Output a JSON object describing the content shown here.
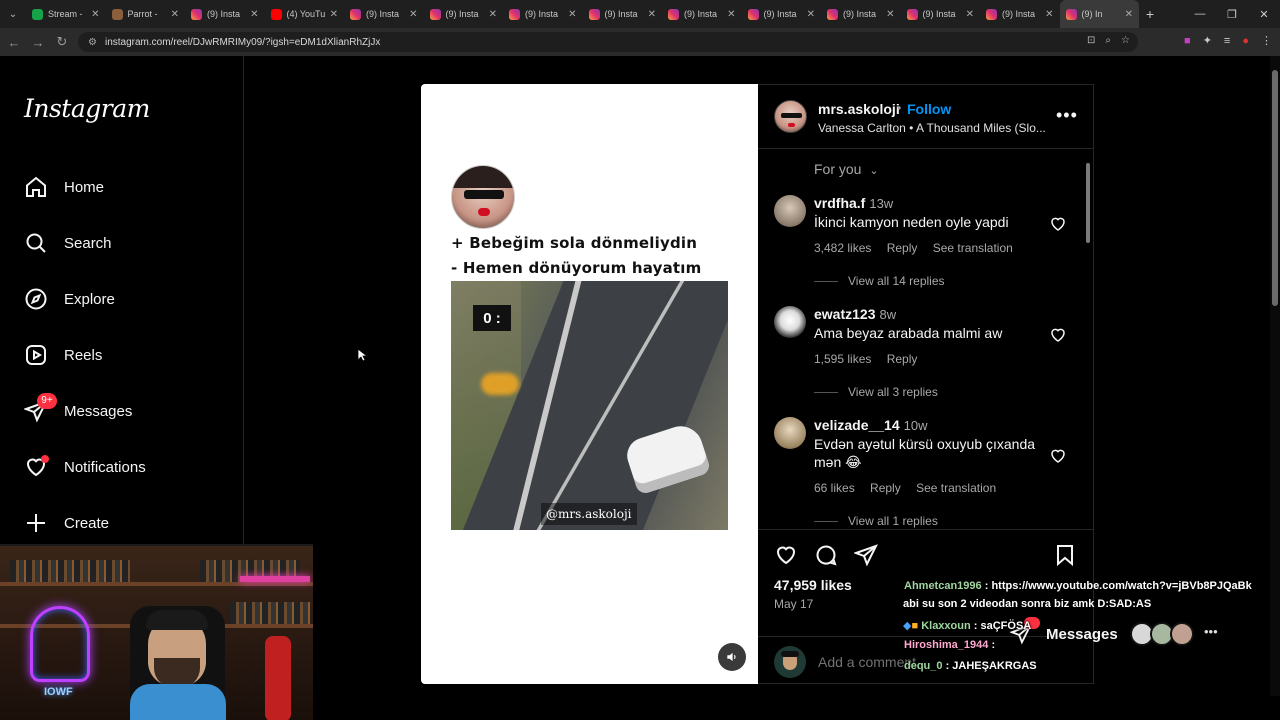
{
  "browser": {
    "tabs": [
      {
        "title": "Stream -",
        "icon": "stream-icon"
      },
      {
        "title": "Parrot -",
        "icon": "parrot-icon"
      },
      {
        "title": "(9) Insta",
        "icon": "instagram-icon"
      },
      {
        "title": "(4) YouTu",
        "icon": "youtube-icon"
      },
      {
        "title": "(9) Insta",
        "icon": "instagram-icon"
      },
      {
        "title": "(9) Insta",
        "icon": "instagram-icon"
      },
      {
        "title": "(9) Insta",
        "icon": "instagram-icon"
      },
      {
        "title": "(9) Insta",
        "icon": "instagram-icon"
      },
      {
        "title": "(9) Insta",
        "icon": "instagram-icon"
      },
      {
        "title": "(9) Insta",
        "icon": "instagram-icon"
      },
      {
        "title": "(9) Insta",
        "icon": "instagram-icon"
      },
      {
        "title": "(9) Insta",
        "icon": "instagram-icon"
      },
      {
        "title": "(9) Insta",
        "icon": "instagram-icon"
      },
      {
        "title": "(9) In",
        "icon": "instagram-icon",
        "active": true
      }
    ],
    "url": "instagram.com/reel/DJwRMRIMy09/?igsh=eDM1dXlianRhZjJx"
  },
  "sidebar": {
    "logo": "Instagram",
    "items": [
      {
        "label": "Home",
        "icon": "home-icon"
      },
      {
        "label": "Search",
        "icon": "search-icon"
      },
      {
        "label": "Explore",
        "icon": "compass-icon"
      },
      {
        "label": "Reels",
        "icon": "reels-icon"
      },
      {
        "label": "Messages",
        "icon": "messenger-icon",
        "badge": "9+"
      },
      {
        "label": "Notifications",
        "icon": "heart-icon"
      },
      {
        "label": "Create",
        "icon": "plus-icon"
      }
    ]
  },
  "reel": {
    "caption_line1": "+ Bebeğim sola dönmeliydin",
    "caption_line2": "- Hemen dönüyorum hayatım",
    "timer": "0 :",
    "watermark": "@mrs.askoloji"
  },
  "post": {
    "username": "mrs.askoloji",
    "separator": "•",
    "follow": "Follow",
    "audio": "Vanessa Carlton • A Thousand Miles (Slo...",
    "filter": "For you",
    "comments": [
      {
        "user": "vrdfha.f",
        "time": "13w",
        "text": "İkinci kamyon neden oyle yapdi",
        "likes": "3,482 likes",
        "reply": "Reply",
        "translate": "See translation",
        "replies": "View all 14 replies"
      },
      {
        "user": "ewatz123",
        "time": "8w",
        "text": "Ama beyaz arabada malmi aw",
        "likes": "1,595 likes",
        "reply": "Reply",
        "translate": "",
        "replies": "View all 3 replies"
      },
      {
        "user": "velizade__14",
        "time": "10w",
        "text": "Evdən ayətul kürsü oxuyub çıxanda mən 😂",
        "likes": "66 likes",
        "reply": "Reply",
        "translate": "See translation",
        "replies": "View all 1 replies"
      }
    ],
    "likes": "47,959 likes",
    "date": "May 17",
    "add_comment_placeholder": "Add a comment..."
  },
  "messages_pill": {
    "label": "Messages"
  },
  "stream_chat": [
    {
      "name": "Ahmetcan1996",
      "sep": " : ",
      "msg": "https://www.youtube.com/watch?v=jBVb8PJQaBk"
    },
    {
      "name": "",
      "sep": "",
      "msg": "abi su son 2 videodan sonra biz amk D:SAD:AS"
    },
    {
      "name": "Klaxxoun",
      "sep": " : ",
      "msg": "saÇFÖSA"
    },
    {
      "name": "Hiroshima_1944",
      "sep": " : ",
      "msg": ""
    },
    {
      "name": "dequ_0",
      "sep": " : ",
      "msg": "JAHEŞAKRGAS"
    }
  ],
  "webcam": {
    "neon_text": "IOWF"
  },
  "colors": {
    "accent": "#0095f6",
    "badge": "#ff3040",
    "background": "#000000"
  }
}
